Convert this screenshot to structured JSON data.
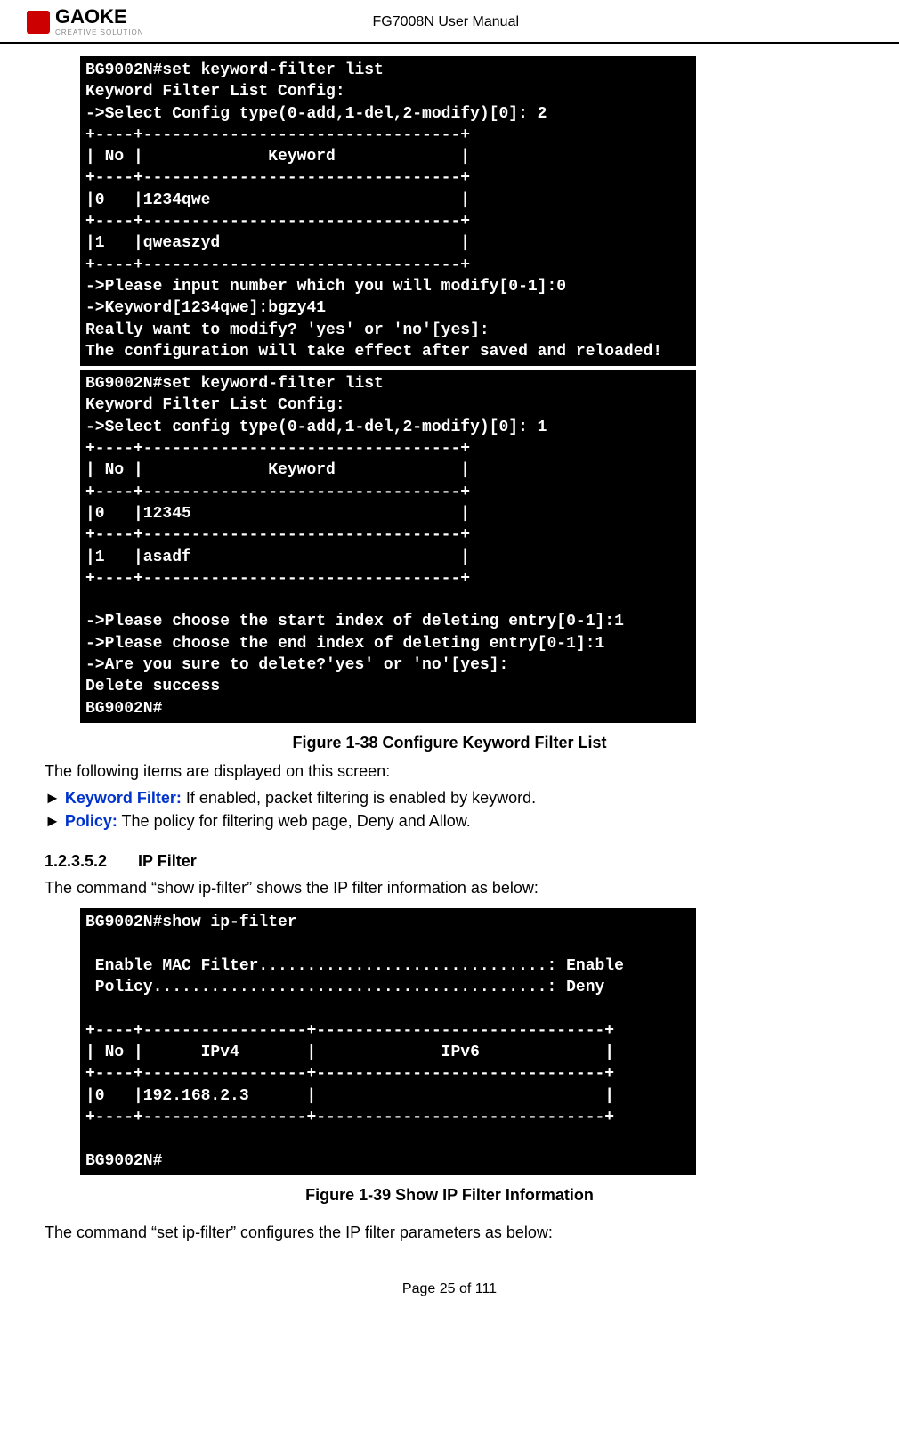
{
  "header": {
    "logo_text": "GAOKE",
    "logo_sub": "CREATIVE SOLUTION",
    "title": "FG7008N User Manual"
  },
  "terminal1_lines": [
    "BG9002N#set keyword-filter list",
    "Keyword Filter List Config:",
    "->Select Config type(0-add,1-del,2-modify)[0]: 2",
    "+----+---------------------------------+",
    "| No |             Keyword             |",
    "+----+---------------------------------+",
    "|0   |1234qwe                          |",
    "+----+---------------------------------+",
    "|1   |qweaszyd                         |",
    "+----+---------------------------------+",
    "->Please input number which you will modify[0-1]:0",
    "->Keyword[1234qwe]:bgzy41",
    "Really want to modify? 'yes' or 'no'[yes]:",
    "The configuration will take effect after saved and reloaded!"
  ],
  "terminal2_lines": [
    "BG9002N#set keyword-filter list",
    "Keyword Filter List Config:",
    "->Select config type(0-add,1-del,2-modify)[0]: 1",
    "+----+---------------------------------+",
    "| No |             Keyword             |",
    "+----+---------------------------------+",
    "|0   |12345                            |",
    "+----+---------------------------------+",
    "|1   |asadf                            |",
    "+----+---------------------------------+",
    "",
    "->Please choose the start index of deleting entry[0-1]:1",
    "->Please choose the end index of deleting entry[0-1]:1",
    "->Are you sure to delete?'yes' or 'no'[yes]:",
    "Delete success",
    "BG9002N#"
  ],
  "caption1": "Figure 1-38    Configure Keyword Filter List",
  "body1": "The following items are displayed on this screen:",
  "bullets": [
    {
      "arrow": "►",
      "label": "Keyword Filter:",
      "desc": "   If enabled, packet filtering is enabled by keyword."
    },
    {
      "arrow": "►",
      "label": "Policy:",
      "desc": "                The policy for filtering web page, Deny and Allow."
    }
  ],
  "section": {
    "num": "1.2.3.5.2",
    "title": "IP Filter"
  },
  "body2": "The command “show ip-filter” shows the IP filter information as below:",
  "terminal3_lines": [
    "BG9002N#show ip-filter",
    "",
    " Enable MAC Filter..............................: Enable",
    " Policy.........................................: Deny",
    "",
    "+----+-----------------+------------------------------+",
    "| No |      IPv4       |             IPv6             |",
    "+----+-----------------+------------------------------+",
    "|0   |192.168.2.3      |                              |",
    "+----+-----------------+------------------------------+",
    "",
    "BG9002N#_"
  ],
  "caption2": "Figure 1-39    Show IP Filter Information",
  "body3": "The command “set ip-filter” configures the IP filter parameters as below:",
  "footer": "Page 25 of 111"
}
